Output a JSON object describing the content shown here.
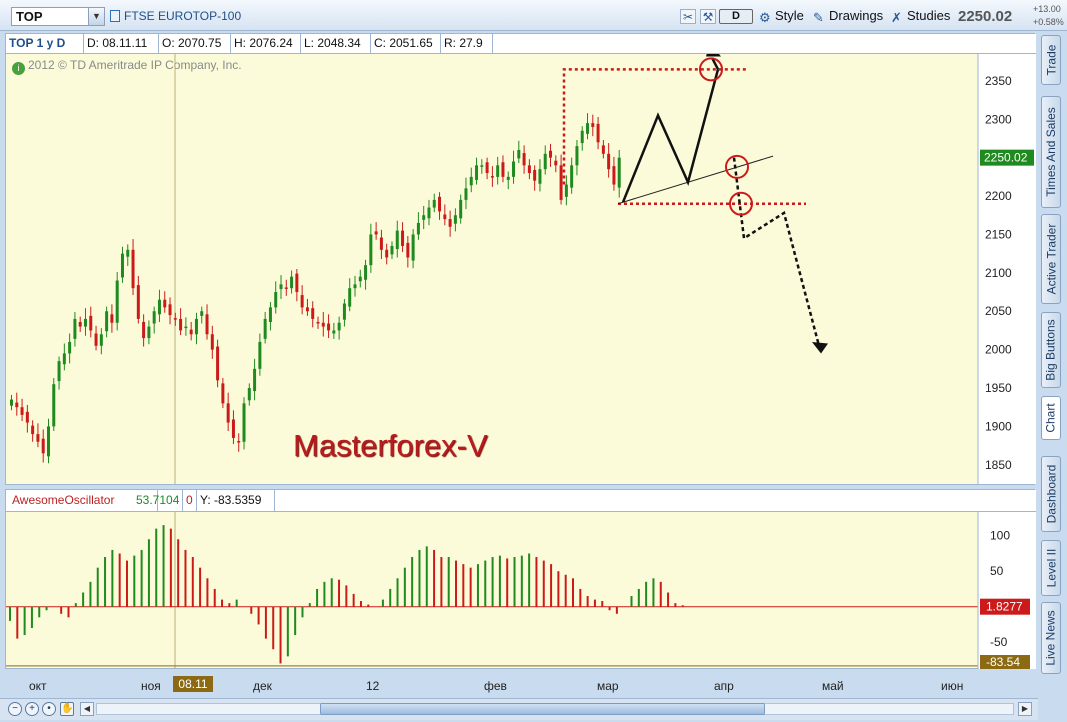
{
  "toolbar": {
    "symbol": "TOP",
    "description": "FTSE EUROTOP-100",
    "aggregation_button": "D",
    "style_label": "Style",
    "drawings_label": "Drawings",
    "studies_label": "Studies",
    "last_price": "2250.02",
    "change_abs": "+13.00",
    "change_pct": "+0.58%"
  },
  "side_tabs": [
    "Trade",
    "Times And Sales",
    "Active Trader",
    "Big Buttons",
    "Chart",
    "Dashboard",
    "Level II",
    "Live News"
  ],
  "info_bar": {
    "symbol_period": "TOP 1 y D",
    "date": "D: 08.11.11",
    "open": "O: 2070.75",
    "high": "H: 2076.24",
    "low": "L: 2048.34",
    "close": "C: 2051.65",
    "range": "R: 27.9"
  },
  "copyright": "2012 © TD Ameritrade IP Company, Inc.",
  "watermark": "Masterforex-V",
  "oscillator_bar": {
    "name": "AwesomeOscillator",
    "value": "53.7104",
    "zero": "0",
    "y_readout": "Y: -83.5359"
  },
  "time_axis": {
    "labels": [
      "окт",
      "ноя",
      "дек",
      "12",
      "фев",
      "мар",
      "апр",
      "май",
      "июн"
    ],
    "cursor_date": "08.11"
  },
  "chart_data": [
    {
      "type": "candlestick",
      "title": "FTSE EUROTOP-100",
      "ylim": [
        1825,
        2385
      ],
      "yticks": [
        1850,
        1900,
        1950,
        2000,
        2050,
        2100,
        2150,
        2200,
        2250,
        2300,
        2350
      ],
      "last_price_label": "2250.02",
      "colors": {
        "up": "#1f8a1f",
        "down": "#cc1a1a",
        "background": "#fbfbd9"
      },
      "ohlc_approx_closes": [
        1935,
        1925,
        1915,
        1905,
        1890,
        1880,
        1865,
        1900,
        1955,
        1985,
        1995,
        2010,
        2040,
        2030,
        2040,
        2025,
        2005,
        2020,
        2050,
        2035,
        2090,
        2125,
        2130,
        2080,
        2040,
        2015,
        2030,
        2050,
        2065,
        2055,
        2045,
        2040,
        2025,
        2030,
        2020,
        2040,
        2050,
        2020,
        2000,
        1960,
        1930,
        1905,
        1885,
        1880,
        1930,
        1950,
        1975,
        2010,
        2040,
        2055,
        2075,
        2085,
        2080,
        2095,
        2075,
        2055,
        2050,
        2040,
        2035,
        2030,
        2025,
        2025,
        2035,
        2060,
        2080,
        2085,
        2095,
        2110,
        2150,
        2150,
        2130,
        2120,
        2135,
        2155,
        2135,
        2120,
        2150,
        2165,
        2175,
        2185,
        2195,
        2180,
        2170,
        2160,
        2175,
        2195,
        2210,
        2225,
        2240,
        2240,
        2230,
        2225,
        2240,
        2225,
        2225,
        2245,
        2260,
        2240,
        2230,
        2220,
        2235,
        2255,
        2250,
        2240,
        2195,
        2215,
        2240,
        2265,
        2285,
        2295,
        2290,
        2270,
        2255,
        2235,
        2215,
        2250
      ]
    },
    {
      "type": "bar",
      "title": "AwesomeOscillator",
      "ylim": [
        -85,
        125
      ],
      "yticks": [
        100,
        50,
        -50
      ],
      "value_labels": [
        "1.8277",
        "-83.54"
      ],
      "colors": {
        "up": "#1f8a1f",
        "down": "#cc1a1a"
      },
      "values": [
        -20,
        -45,
        -40,
        -30,
        -15,
        -5,
        0,
        -10,
        -15,
        5,
        20,
        35,
        55,
        70,
        80,
        75,
        65,
        72,
        80,
        95,
        110,
        115,
        110,
        95,
        80,
        70,
        55,
        40,
        25,
        10,
        5,
        10,
        0,
        -10,
        -25,
        -45,
        -60,
        -80,
        -70,
        -40,
        -15,
        5,
        25,
        35,
        40,
        38,
        30,
        18,
        8,
        3,
        0,
        10,
        25,
        40,
        55,
        70,
        80,
        85,
        80,
        70,
        70,
        65,
        60,
        55,
        60,
        65,
        70,
        72,
        68,
        70,
        72,
        75,
        70,
        65,
        60,
        50,
        45,
        40,
        25,
        15,
        10,
        8,
        -5,
        -10,
        0,
        15,
        25,
        35,
        40,
        35,
        20,
        5,
        2
      ]
    }
  ]
}
